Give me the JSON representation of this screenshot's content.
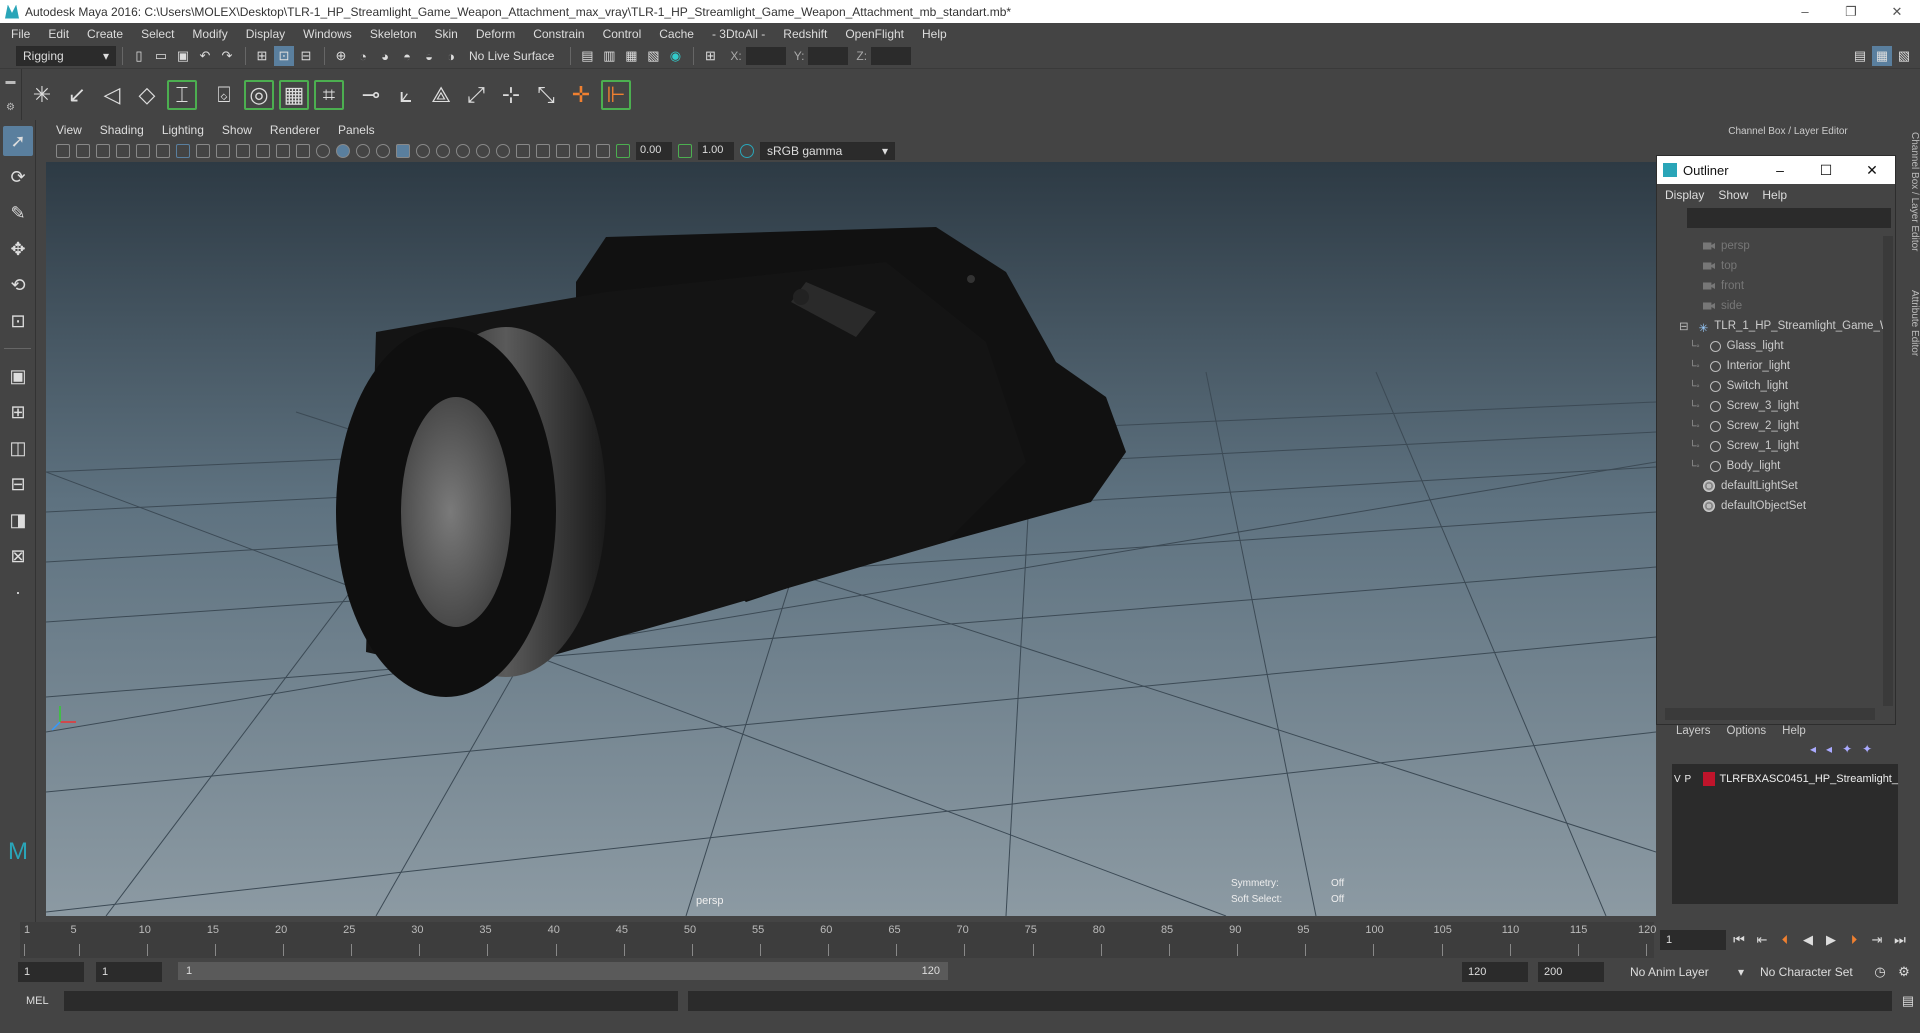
{
  "app": {
    "title": "Autodesk Maya 2016: C:\\Users\\MOLEX\\Desktop\\TLR-1_HP_Streamlight_Game_Weapon_Attachment_max_vray\\TLR-1_HP_Streamlight_Game_Weapon_Attachment_mb_standart.mb*",
    "window_controls": [
      "–",
      "❐",
      "✕"
    ]
  },
  "menubar": [
    "File",
    "Edit",
    "Create",
    "Select",
    "Modify",
    "Display",
    "Windows",
    "Skeleton",
    "Skin",
    "Deform",
    "Constrain",
    "Control",
    "Cache",
    "- 3DtoAll -",
    "Redshift",
    "OpenFlight",
    "Help"
  ],
  "statusline": {
    "menuset": "Rigging",
    "live_surface": "No Live Surface",
    "x_label": "X:",
    "y_label": "Y:",
    "z_label": "Z:"
  },
  "viewport": {
    "menu": [
      "View",
      "Shading",
      "Lighting",
      "Show",
      "Renderer",
      "Panels"
    ],
    "exposure": "0.00",
    "gamma": "1.00",
    "color_space": "sRGB gamma",
    "camera_label": "persp",
    "symmetry_label": "Symmetry:",
    "symmetry_value": "Off",
    "soft_select_label": "Soft Select:",
    "soft_select_value": "Off"
  },
  "channel_box": {
    "title": "Channel Box / Layer Editor",
    "side_tabs": [
      "Channel Box / Layer Editor",
      "Attribute Editor"
    ]
  },
  "outliner": {
    "title": "Outliner",
    "menu": [
      "Display",
      "Show",
      "Help"
    ],
    "items": [
      {
        "label": "persp",
        "type": "camera",
        "dim": true,
        "indent": 0
      },
      {
        "label": "top",
        "type": "camera",
        "dim": true,
        "indent": 0
      },
      {
        "label": "front",
        "type": "camera",
        "dim": true,
        "indent": 0
      },
      {
        "label": "side",
        "type": "camera",
        "dim": true,
        "indent": 0
      },
      {
        "label": "TLR_1_HP_Streamlight_Game_W",
        "type": "group",
        "dim": false,
        "indent": 0
      },
      {
        "label": "Glass_light",
        "type": "mesh",
        "dim": false,
        "indent": 1
      },
      {
        "label": "Interior_light",
        "type": "mesh",
        "dim": false,
        "indent": 1
      },
      {
        "label": "Switch_light",
        "type": "mesh",
        "dim": false,
        "indent": 1
      },
      {
        "label": "Screw_3_light",
        "type": "mesh",
        "dim": false,
        "indent": 1
      },
      {
        "label": "Screw_2_light",
        "type": "mesh",
        "dim": false,
        "indent": 1
      },
      {
        "label": "Screw_1_light",
        "type": "mesh",
        "dim": false,
        "indent": 1
      },
      {
        "label": "Body_light",
        "type": "mesh",
        "dim": false,
        "indent": 1
      },
      {
        "label": "defaultLightSet",
        "type": "set",
        "dim": false,
        "indent": 0
      },
      {
        "label": "defaultObjectSet",
        "type": "set",
        "dim": false,
        "indent": 0
      }
    ]
  },
  "layers": {
    "menu": [
      "Layers",
      "Options",
      "Help"
    ],
    "rows": [
      {
        "v": "V",
        "p": "P",
        "color": "#c0142b",
        "name": "TLRFBXASC0451_HP_Streamlight_"
      }
    ]
  },
  "timeline": {
    "ticks": [
      "1",
      "5",
      "10",
      "15",
      "20",
      "25",
      "30",
      "35",
      "40",
      "45",
      "50",
      "55",
      "60",
      "65",
      "70",
      "75",
      "80",
      "85",
      "90",
      "95",
      "100",
      "105",
      "110",
      "115",
      "120"
    ],
    "current_frame": "1"
  },
  "range": {
    "start": "1",
    "playback_start": "1",
    "bar_start": "1",
    "bar_end": "120",
    "playback_end": "120",
    "end": "200",
    "anim_layer": "No Anim Layer",
    "character_set": "No Character Set"
  },
  "commandline": {
    "label": "MEL"
  },
  "colors": {
    "bg": "#444444",
    "field": "#2b2b2b",
    "accent": "#5a7f9e",
    "layer_red": "#c0142b"
  }
}
